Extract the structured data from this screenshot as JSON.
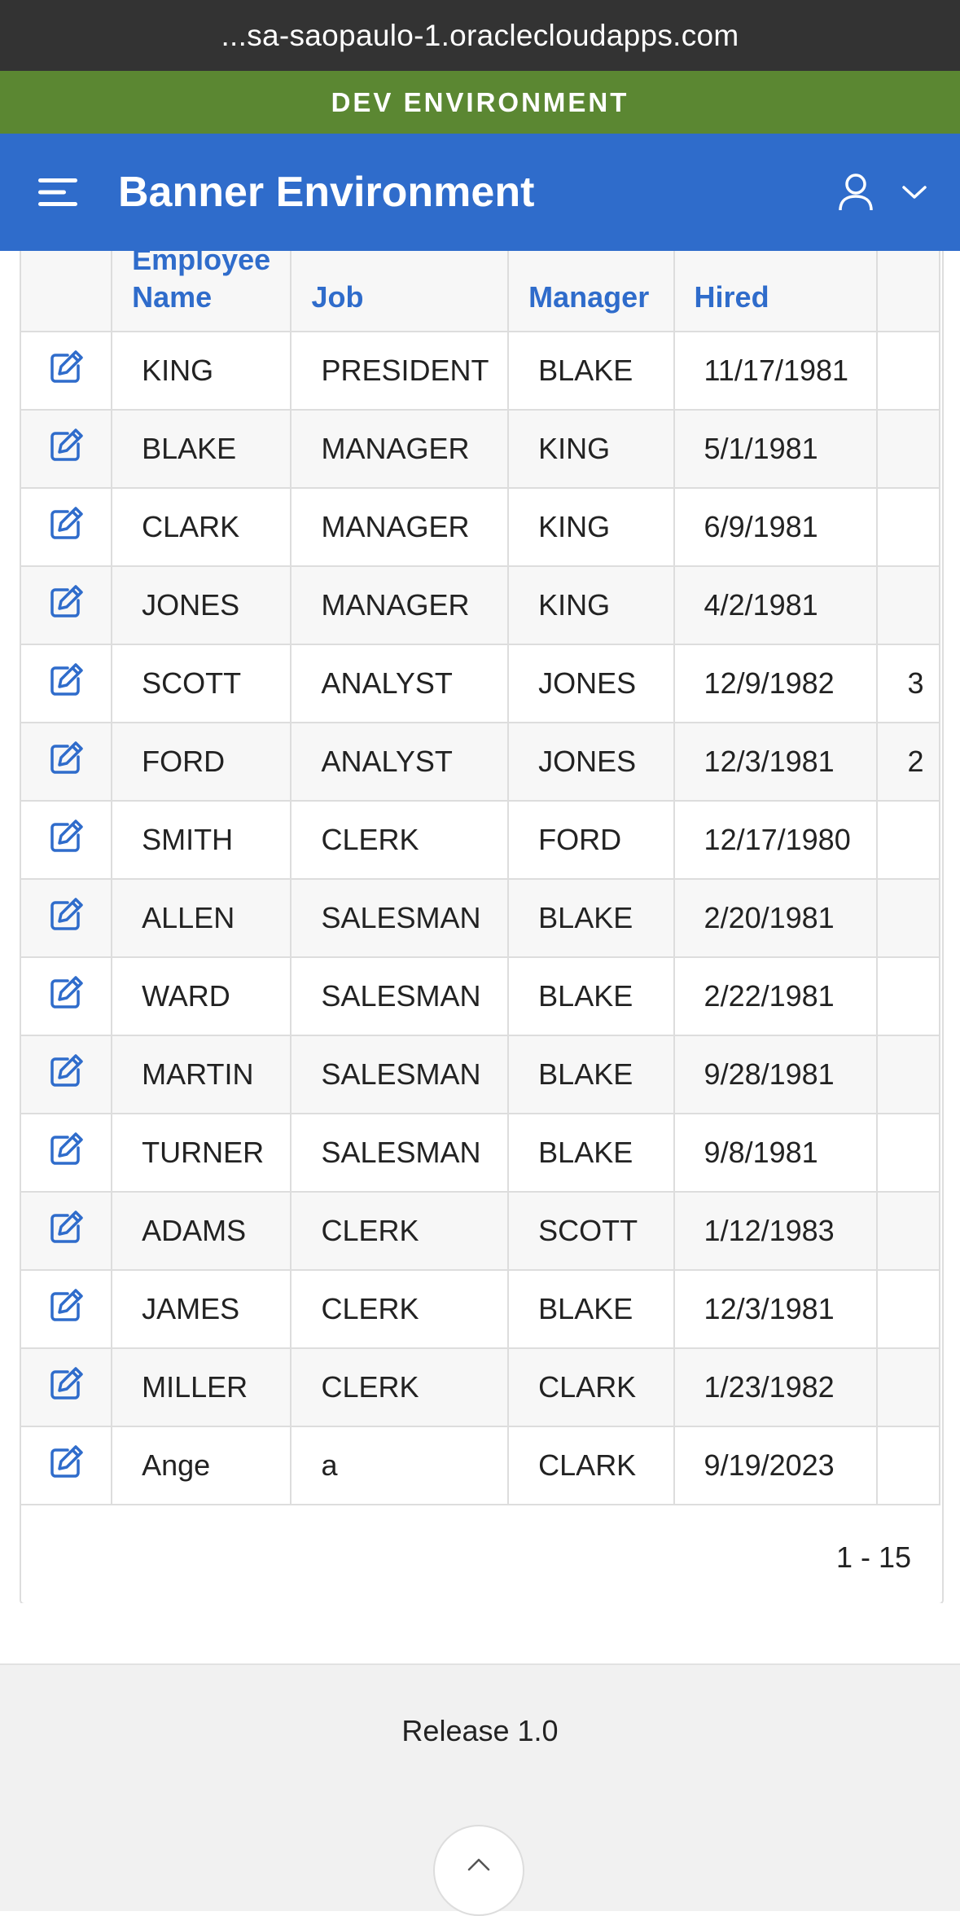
{
  "browser": {
    "url": "...sa-saopaulo-1.oraclecloudapps.com"
  },
  "env_banner": {
    "label": "DEV ENVIRONMENT",
    "color": "#5b8732"
  },
  "header": {
    "title": "Banner Environment",
    "menu_icon": "hamburger-menu-icon",
    "user_icon": "user-icon",
    "dropdown_icon": "chevron-down-icon",
    "color": "#2f6ccb"
  },
  "grid": {
    "columns": [
      "",
      "Employee Name",
      "Job",
      "Manager",
      "Hired"
    ],
    "rows": [
      {
        "name": "KING",
        "job": "PRESIDENT",
        "manager": "BLAKE",
        "hired": "11/17/1981",
        "extra": ""
      },
      {
        "name": "BLAKE",
        "job": "MANAGER",
        "manager": "KING",
        "hired": "5/1/1981",
        "extra": ""
      },
      {
        "name": "CLARK",
        "job": "MANAGER",
        "manager": "KING",
        "hired": "6/9/1981",
        "extra": ""
      },
      {
        "name": "JONES",
        "job": "MANAGER",
        "manager": "KING",
        "hired": "4/2/1981",
        "extra": ""
      },
      {
        "name": "SCOTT",
        "job": "ANALYST",
        "manager": "JONES",
        "hired": "12/9/1982",
        "extra": "3"
      },
      {
        "name": "FORD",
        "job": "ANALYST",
        "manager": "JONES",
        "hired": "12/3/1981",
        "extra": "2"
      },
      {
        "name": "SMITH",
        "job": "CLERK",
        "manager": "FORD",
        "hired": "12/17/1980",
        "extra": ""
      },
      {
        "name": "ALLEN",
        "job": "SALESMAN",
        "manager": "BLAKE",
        "hired": "2/20/1981",
        "extra": ""
      },
      {
        "name": "WARD",
        "job": "SALESMAN",
        "manager": "BLAKE",
        "hired": "2/22/1981",
        "extra": ""
      },
      {
        "name": "MARTIN",
        "job": "SALESMAN",
        "manager": "BLAKE",
        "hired": "9/28/1981",
        "extra": ""
      },
      {
        "name": "TURNER",
        "job": "SALESMAN",
        "manager": "BLAKE",
        "hired": "9/8/1981",
        "extra": ""
      },
      {
        "name": "ADAMS",
        "job": "CLERK",
        "manager": "SCOTT",
        "hired": "1/12/1983",
        "extra": ""
      },
      {
        "name": "JAMES",
        "job": "CLERK",
        "manager": "BLAKE",
        "hired": "12/3/1981",
        "extra": ""
      },
      {
        "name": "MILLER",
        "job": "CLERK",
        "manager": "CLARK",
        "hired": "1/23/1982",
        "extra": ""
      },
      {
        "name": "Ange",
        "job": "a",
        "manager": "CLARK",
        "hired": "9/19/2023",
        "extra": ""
      }
    ],
    "edit_icon": "edit-icon",
    "pagination": "1 - 15"
  },
  "footer": {
    "release": "Release 1.0",
    "top_icon": "chevron-up-icon"
  }
}
